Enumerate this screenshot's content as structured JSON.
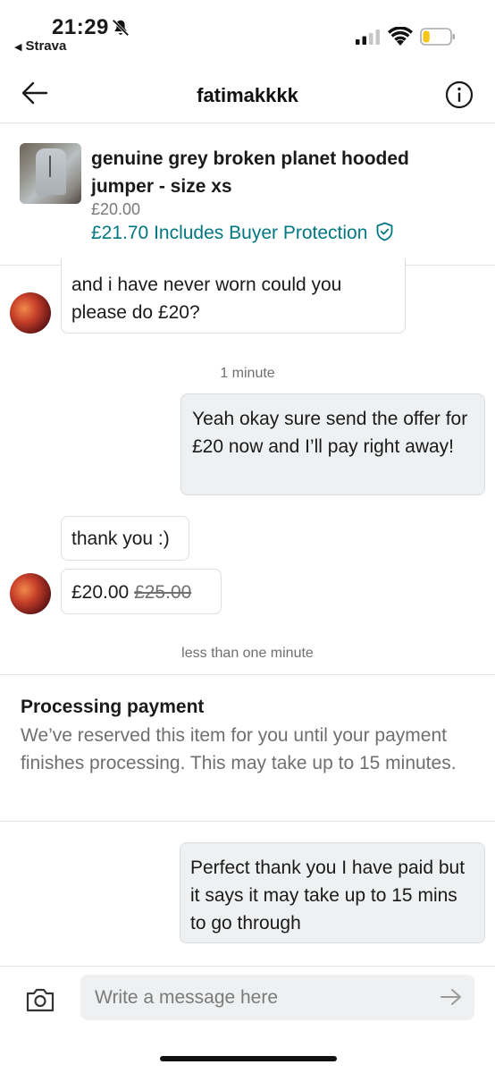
{
  "status_bar": {
    "time": "21:29",
    "back_app": "Strava",
    "icons": [
      "bell-slash-icon",
      "signal-icon",
      "wifi-icon",
      "battery-icon"
    ],
    "battery_level": 0.25
  },
  "header": {
    "title": "fatimakkkk",
    "icons": [
      "back-arrow-icon",
      "info-icon"
    ]
  },
  "item": {
    "title": "genuine grey broken planet hooded jumper - size xs",
    "price": "£20.00",
    "total": "£21.70",
    "protection_text": "Includes Buyer Protection"
  },
  "messages": [
    {
      "direction": "in",
      "text": "and i have never worn could you please do £20?"
    },
    {
      "direction": "out",
      "text": "Yeah okay sure send the offer for £20 now and I’ll pay right away!"
    },
    {
      "direction": "in",
      "text": "thank you :)"
    },
    {
      "direction": "in",
      "offer_price": "£20.00",
      "original_price": "£25.00"
    },
    {
      "direction": "out",
      "text": "Perfect thank you I have paid but it says it may take up to 15 mins to go through"
    }
  ],
  "timestamps": [
    "1 minute",
    "less than one minute"
  ],
  "processing": {
    "title": "Processing payment",
    "body": "We’ve reserved this item for you until your payment finishes processing. This may take up to 15 minutes."
  },
  "composer": {
    "placeholder": "Write a message here"
  },
  "colors": {
    "accent": "#007782",
    "bubble_out": "#eef0f1",
    "bubble_in_border": "#dedede",
    "battery_fill": "#f5c518"
  }
}
